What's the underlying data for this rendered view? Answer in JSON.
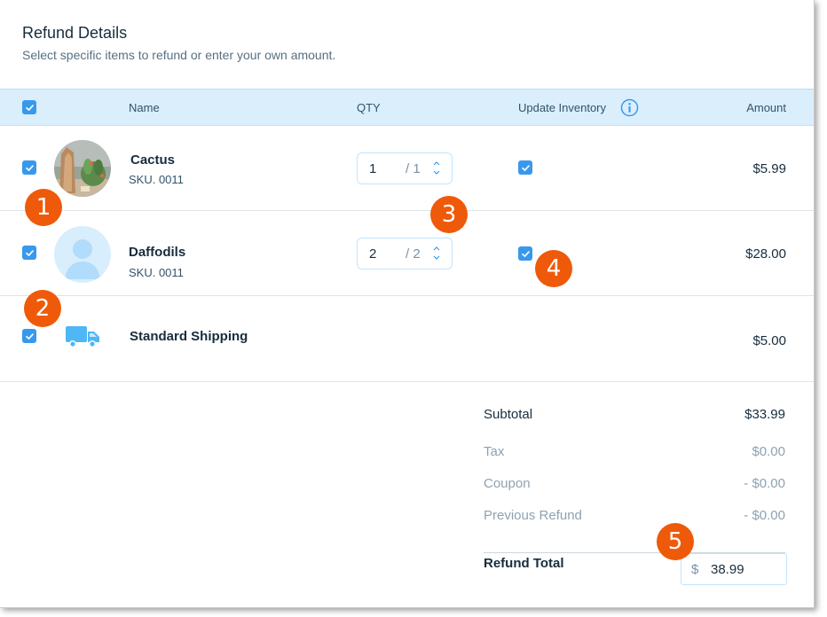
{
  "header": {
    "title": "Refund Details",
    "subtitle": "Select specific items to refund or enter your own amount."
  },
  "table": {
    "columns": {
      "name": "Name",
      "qty": "QTY",
      "update_inventory": "Update Inventory",
      "amount": "Amount"
    },
    "items": [
      {
        "name": "Cactus",
        "sku": "SKU. 0011",
        "qty": "1",
        "max": "/ 1",
        "amount": "$5.99",
        "checked": true,
        "update_inventory": true
      },
      {
        "name": "Daffodils",
        "sku": "SKU. 0011",
        "qty": "2",
        "max": "/ 2",
        "amount": "$28.00",
        "checked": true,
        "update_inventory": true
      }
    ],
    "shipping": {
      "name": "Standard Shipping",
      "amount": "$5.00",
      "checked": true
    }
  },
  "summary": {
    "subtotal_label": "Subtotal",
    "subtotal": "$33.99",
    "tax_label": "Tax",
    "tax": "$0.00",
    "coupon_label": "Coupon",
    "coupon": "- $0.00",
    "previous_refund_label": "Previous Refund",
    "previous_refund": "- $0.00",
    "refund_total_label": "Refund Total",
    "currency": "$",
    "refund_total": "38.99"
  },
  "callouts": [
    "1",
    "2",
    "3",
    "4",
    "5"
  ],
  "colors": {
    "accent": "#3899ec",
    "callout": "#ee5a0a",
    "header_bg": "#daeefc"
  },
  "icons": [
    "check-icon",
    "info-icon",
    "chevron-up-icon",
    "chevron-down-icon",
    "truck-icon",
    "user-placeholder-icon"
  ]
}
